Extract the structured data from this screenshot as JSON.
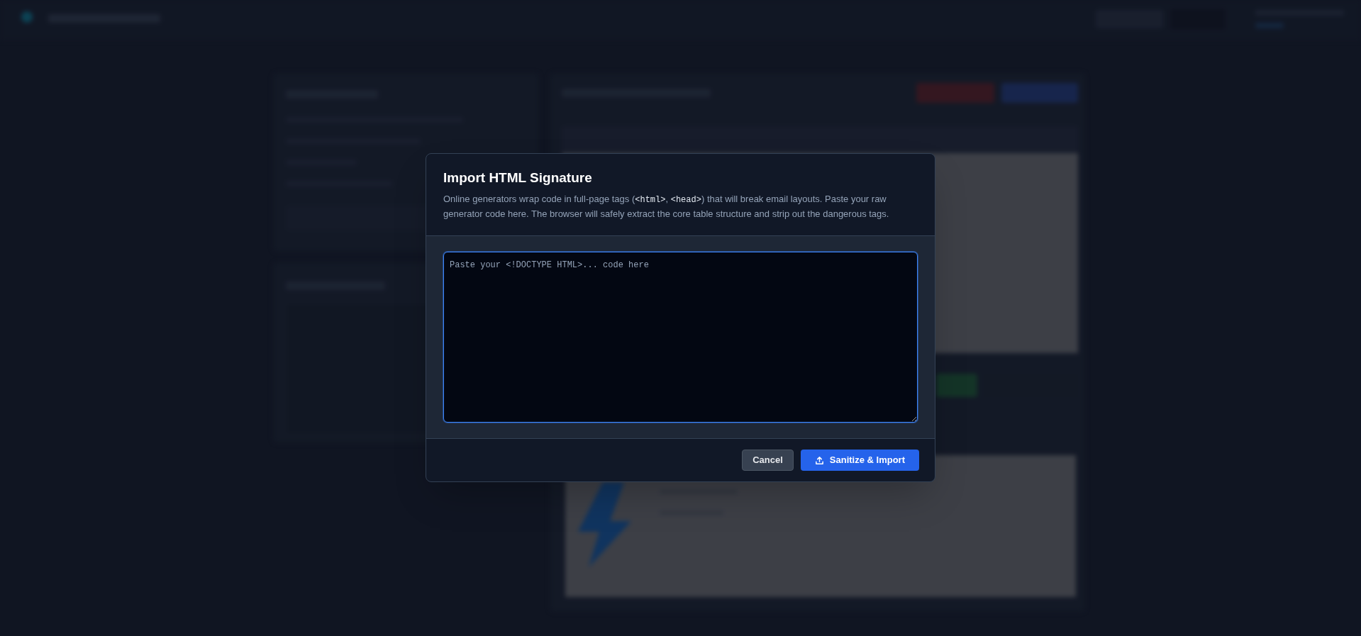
{
  "dialog": {
    "title": "Import HTML Signature",
    "description": [
      {
        "kind": "text",
        "text": "Online generators wrap code in full-page tags ("
      },
      {
        "kind": "code",
        "text": "<html>"
      },
      {
        "kind": "text",
        "text": ", "
      },
      {
        "kind": "code",
        "text": "<head>"
      },
      {
        "kind": "text",
        "text": ") that will break email layouts. Paste your raw generator code here. The browser will safely extract the core table structure and strip out the dangerous tags."
      }
    ],
    "code_field": {
      "placeholder": "Paste your <!DOCTYPE HTML>... code here"
    },
    "buttons": [
      {
        "kind": "secondary",
        "label": "Cancel"
      },
      {
        "kind": "primary",
        "label": "Sanitize & Import"
      }
    ]
  }
}
